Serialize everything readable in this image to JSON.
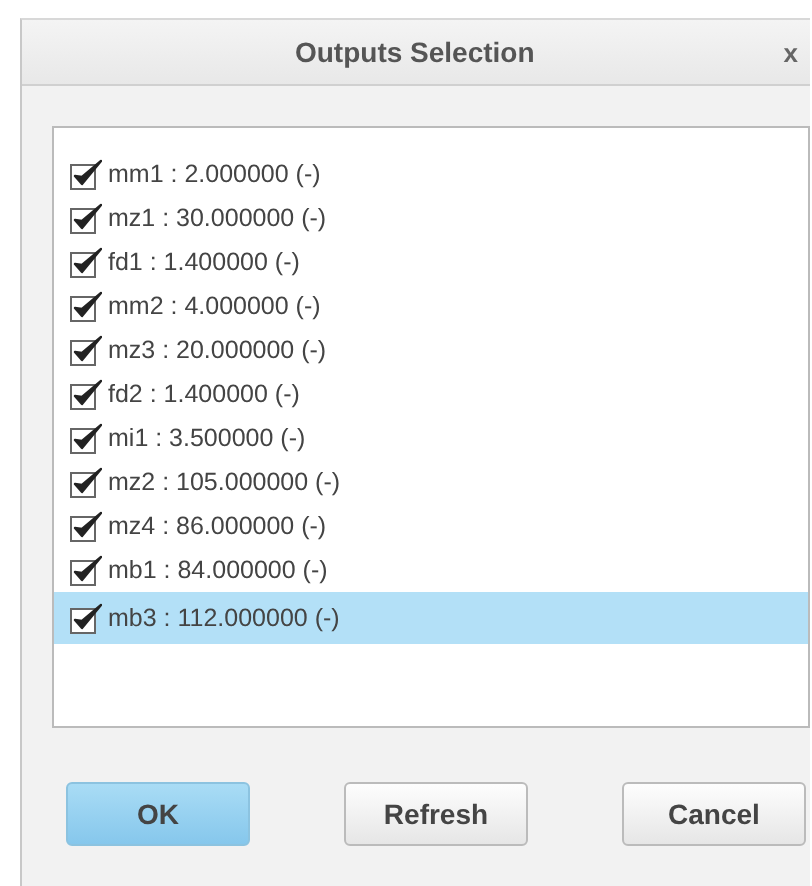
{
  "window": {
    "title": "Outputs Selection",
    "close": "x"
  },
  "outputs": [
    {
      "label": "mm1 : 2.000000 (-)",
      "checked": true,
      "selected": false
    },
    {
      "label": "mz1 : 30.000000 (-)",
      "checked": true,
      "selected": false
    },
    {
      "label": "fd1 : 1.400000 (-)",
      "checked": true,
      "selected": false
    },
    {
      "label": "mm2 : 4.000000 (-)",
      "checked": true,
      "selected": false
    },
    {
      "label": "mz3 : 20.000000 (-)",
      "checked": true,
      "selected": false
    },
    {
      "label": "fd2 : 1.400000 (-)",
      "checked": true,
      "selected": false
    },
    {
      "label": "mi1 : 3.500000 (-)",
      "checked": true,
      "selected": false
    },
    {
      "label": "mz2 : 105.000000 (-)",
      "checked": true,
      "selected": false
    },
    {
      "label": "mz4 : 86.000000 (-)",
      "checked": true,
      "selected": false
    },
    {
      "label": "mb1 : 84.000000 (-)",
      "checked": true,
      "selected": false
    },
    {
      "label": "mb3 : 112.000000 (-)",
      "checked": true,
      "selected": true
    }
  ],
  "buttons": [
    {
      "label": "OK",
      "kind": "primary"
    },
    {
      "label": "Refresh",
      "kind": "normal"
    },
    {
      "label": "Cancel",
      "kind": "normal"
    }
  ]
}
